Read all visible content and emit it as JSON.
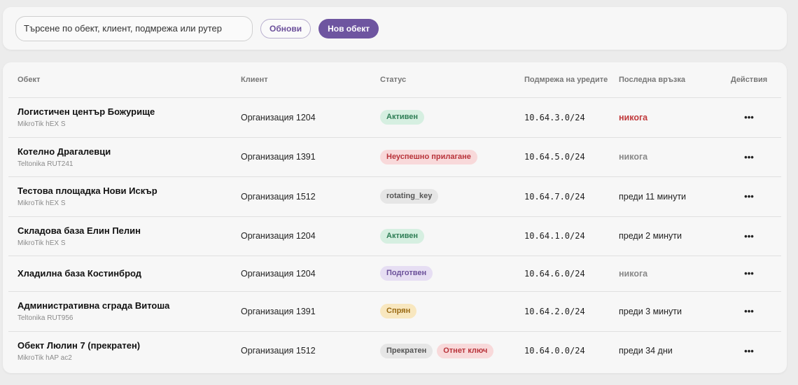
{
  "toolbar": {
    "search_placeholder": "Търсене по обект, клиент, подмрежа или рутер",
    "refresh_label": "Обнови",
    "new_label": "Нов обект"
  },
  "table": {
    "headers": {
      "object": "Обект",
      "client": "Клиент",
      "status": "Статус",
      "subnet": "Подмрежа на уредите",
      "last_conn": "Последна връзка",
      "actions": "Действия"
    },
    "actions_glyph": "•••",
    "rows": [
      {
        "name": "Логистичен център Божурище",
        "model": "MikroTik hEX S",
        "client": "Организация 1204",
        "badges": [
          {
            "label": "Активен",
            "bg": "#d6efe1",
            "fg": "#2e7d55"
          }
        ],
        "subnet": "10.64.3.0/24",
        "last": "никога",
        "last_style": "never-red"
      },
      {
        "name": "Котелно Драгалевци",
        "model": "Teltonika RUT241",
        "client": "Организация 1391",
        "badges": [
          {
            "label": "Неуспешно прилагане",
            "bg": "#f8d9da",
            "fg": "#b8333a"
          }
        ],
        "subnet": "10.64.5.0/24",
        "last": "никога",
        "last_style": "never"
      },
      {
        "name": "Тестова площадка Нови Искър",
        "model": "MikroTik hEX S",
        "client": "Организация 1512",
        "badges": [
          {
            "label": "rotating_key",
            "bg": "#e6e6e6",
            "fg": "#555555"
          }
        ],
        "subnet": "10.64.7.0/24",
        "last": "преди 11 минути",
        "last_style": "normal"
      },
      {
        "name": "Складова база Елин Пелин",
        "model": "MikroTik hEX S",
        "client": "Организация 1204",
        "badges": [
          {
            "label": "Активен",
            "bg": "#d6efe1",
            "fg": "#2e7d55"
          }
        ],
        "subnet": "10.64.1.0/24",
        "last": "преди 2 минути",
        "last_style": "normal"
      },
      {
        "name": "Хладилна база Костинброд",
        "model": "",
        "client": "Организация 1204",
        "badges": [
          {
            "label": "Подготвен",
            "bg": "#e6def3",
            "fg": "#6a4f99"
          }
        ],
        "subnet": "10.64.6.0/24",
        "last": "никога",
        "last_style": "never"
      },
      {
        "name": "Административна сграда Витоша",
        "model": "Teltonika RUT956",
        "client": "Организация 1391",
        "badges": [
          {
            "label": "Спрян",
            "bg": "#f8e7bf",
            "fg": "#9a6a14"
          }
        ],
        "subnet": "10.64.2.0/24",
        "last": "преди 3 минути",
        "last_style": "normal"
      },
      {
        "name": "Обект Люлин 7 (прекратен)",
        "model": "MikroTik hAP ac2",
        "client": "Организация 1512",
        "badges": [
          {
            "label": "Прекратен",
            "bg": "#e6e6e6",
            "fg": "#555555"
          },
          {
            "label": "Отнет ключ",
            "bg": "#f8d9da",
            "fg": "#b8333a"
          }
        ],
        "subnet": "10.64.0.0/24",
        "last": "преди 34 дни",
        "last_style": "normal"
      }
    ]
  }
}
